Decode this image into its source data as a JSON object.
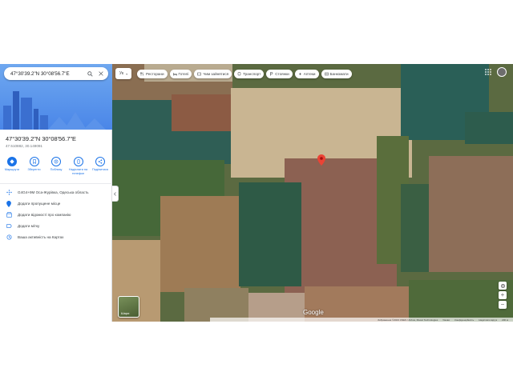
{
  "search": {
    "query": "47°30'39.2\"N 30°08'56.7\"E"
  },
  "place": {
    "title": "47°30'39.2\"N 30°08'56.7\"E",
    "decimal": "47.510882, 30.149091"
  },
  "actions": [
    {
      "label": "Маршрути",
      "icon": "directions-icon"
    },
    {
      "label": "Зберегти",
      "icon": "bookmark-icon"
    },
    {
      "label": "Поблизу",
      "icon": "nearby-icon"
    },
    {
      "label": "Надіслати на телефон",
      "icon": "send-to-phone-icon"
    },
    {
      "label": "Поділитися",
      "icon": "share-icon"
    }
  ],
  "info": [
    {
      "text": "G4G4+9M Оса-Журівка, Одеська область",
      "icon": "plus-code-icon"
    },
    {
      "text": "Додати пропущене місце",
      "icon": "add-place-icon"
    },
    {
      "text": "Додати відомості про компанію",
      "icon": "add-business-icon"
    },
    {
      "text": "Додати мітку",
      "icon": "label-icon"
    },
    {
      "text": "Ваша активність на Картах",
      "icon": "history-icon"
    }
  ],
  "map": {
    "language_button": "Ук",
    "chips": [
      {
        "label": "Ресторани",
        "icon": "restaurant-icon"
      },
      {
        "label": "Готелі",
        "icon": "hotel-icon"
      },
      {
        "label": "Чим зайнятися",
        "icon": "things-to-do-icon"
      },
      {
        "label": "Транспорт",
        "icon": "transit-icon"
      },
      {
        "label": "Стоянки",
        "icon": "parking-icon"
      },
      {
        "label": "Аптеки",
        "icon": "pharmacy-icon"
      },
      {
        "label": "Банкомати",
        "icon": "atm-icon"
      }
    ],
    "layers_label": "Шари",
    "brand": "Google",
    "footer": [
      "Зображення ©2023 CNES / Airbus, Maxar Technologies",
      "Умови",
      "Конфіденційність",
      "Надіслати відгук",
      "200 м"
    ]
  },
  "colors": {
    "accent": "#1a73e8",
    "pin": "#ea4335"
  }
}
